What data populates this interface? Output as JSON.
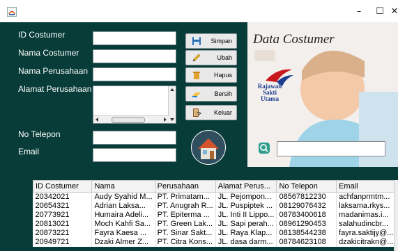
{
  "window": {
    "minimize_glyph": "–",
    "maximize_glyph": "☐",
    "close_glyph": "✕"
  },
  "form": {
    "labels": {
      "id": "ID Costumer",
      "nama": "Nama Costumer",
      "perusahaan": "Nama Perusahaan",
      "alamat": "Alamat Perusahaan",
      "telepon": "No Telepon",
      "email": "Email"
    },
    "values": {
      "id": "",
      "nama": "",
      "perusahaan": "",
      "alamat": "",
      "telepon": "",
      "email": ""
    }
  },
  "buttons": {
    "simpan": "Simpan",
    "ubah": "Ubah",
    "hapus": "Hapus",
    "bersih": "Bersih",
    "keluar": "Keluar"
  },
  "brand": {
    "title": "Data Costumer",
    "logo_line1": "Rajawali",
    "logo_line2": "Sakti",
    "logo_line3": "Utama"
  },
  "search": {
    "value": ""
  },
  "table": {
    "columns": [
      "ID Costumer",
      "Nama",
      "Perusahaan",
      "Alamat Perus...",
      "No Telepon",
      "Email"
    ],
    "rows": [
      [
        "20342021",
        "Audy Syahid M...",
        "PT. Primatam...",
        "JL. Pejompon...",
        "08567812230",
        "achfanprmtm..."
      ],
      [
        "20654321",
        "Adrian Laksa...",
        "PT. Anugrah R...",
        "JL. Puspiptek ...",
        "08129076432",
        "laksama.rkys..."
      ],
      [
        "20773921",
        "Humaira Adeli...",
        "PT. Epiterma ...",
        "JL. Inti II Lippo...",
        "08783400618",
        "madanimas.i..."
      ],
      [
        "20813021",
        "Moch Kahfi Sa...",
        "PT. Green Lak...",
        "JL. Sapi perah...",
        "08961290453",
        "salahudincbr..."
      ],
      [
        "20873221",
        "Fayra Kaesa ...",
        "PT. Sinar Sakt...",
        "JL. Raya Klap...",
        "08138544238",
        "fayra.saktijy@..."
      ],
      [
        "20949721",
        "Dzaki Almer Z...",
        "PT. Citra Kons...",
        "JL. dasa darm...",
        "08784623108",
        "dzakicitrakn@..."
      ]
    ]
  },
  "colors": {
    "panel_bg": "#073c38",
    "brand_bg": "#f2efed",
    "accent_red": "#c8161d",
    "accent_blue": "#1d3d8f"
  }
}
